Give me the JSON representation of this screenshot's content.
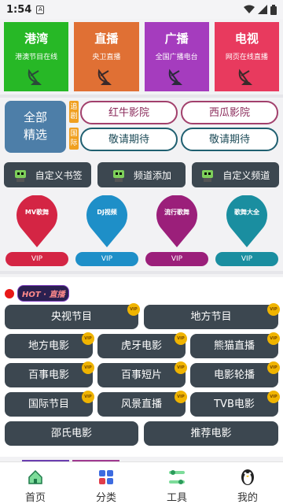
{
  "status": {
    "time": "1:54",
    "sim": "A"
  },
  "categories": [
    {
      "title": "港湾",
      "subtitle": "港澳节目在线",
      "color": "#27b826",
      "icon": "satellite-dish-icon"
    },
    {
      "title": "直播",
      "subtitle": "央卫直播",
      "color": "#e07034",
      "icon": "satellite-dish-icon"
    },
    {
      "title": "广播",
      "subtitle": "全国广播电台",
      "color": "#a53cbe",
      "icon": "satellite-dish-icon"
    },
    {
      "title": "电视",
      "subtitle": "网页在线直播",
      "color": "#e83a5e",
      "icon": "satellite-dish-icon"
    }
  ],
  "quick": {
    "all_line1": "全部",
    "all_line2": "精选",
    "tag1": "追剧",
    "tag2": "国际",
    "row1": [
      "红牛影院",
      "西瓜影院"
    ],
    "row2": [
      "敬请期待",
      "敬请期待"
    ]
  },
  "tools": [
    {
      "label": "自定义书签",
      "icon": "robot-icon"
    },
    {
      "label": "频道添加",
      "icon": "robot-icon"
    },
    {
      "label": "自定义频道",
      "icon": "robot-icon"
    }
  ],
  "pins": [
    {
      "label": "MV歌舞",
      "color": "#d42544",
      "vip": "VIP"
    },
    {
      "label": "DJ视频",
      "color": "#1e8fc8",
      "vip": "VIP"
    },
    {
      "label": "流行歌舞",
      "color": "#9b1f7a",
      "vip": "VIP"
    },
    {
      "label": "歌舞大全",
      "color": "#1a8ea0",
      "vip": "VIP"
    }
  ],
  "live": {
    "badge": "HOT · 直播",
    "vip_badge": "VIP",
    "channels": [
      [
        "央视节目",
        "地方节目"
      ],
      [
        "地方电影",
        "虎牙电影",
        "熊猫直播"
      ],
      [
        "百事电影",
        "百事短片",
        "电影轮播"
      ],
      [
        "国际节目",
        "风景直播",
        "TVB电影"
      ],
      [
        "邵氏电影",
        "推荐电影"
      ]
    ]
  },
  "tabs": [
    {
      "label": "首页",
      "icon": "home-icon",
      "color": "#1fa060"
    },
    {
      "label": "分类",
      "icon": "category-icon",
      "color": "#3d6be0"
    },
    {
      "label": "工具",
      "icon": "tools-icon",
      "color": "#2a9a5a"
    },
    {
      "label": "我的",
      "icon": "penguin-icon",
      "color": "#222222"
    }
  ]
}
